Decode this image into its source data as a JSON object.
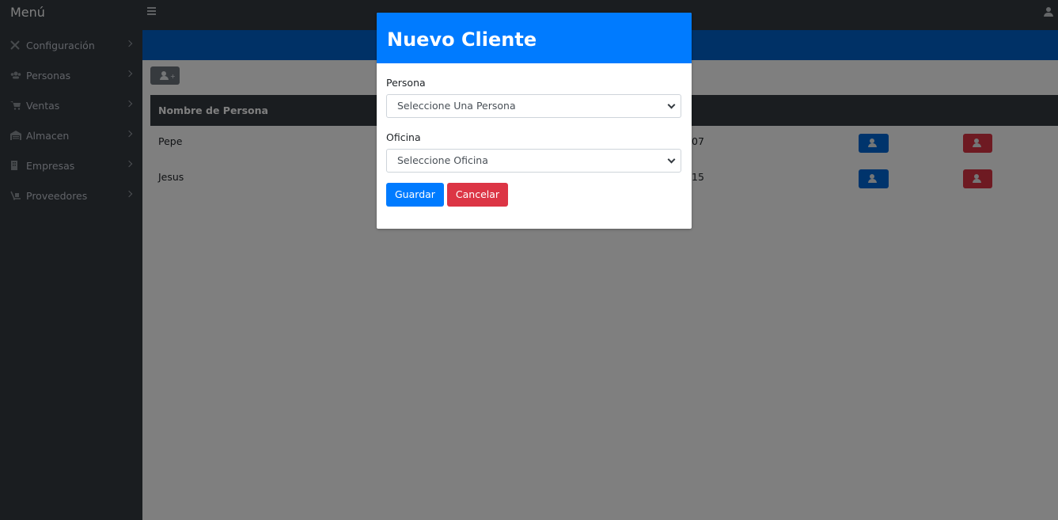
{
  "header": {
    "brand": "Menú"
  },
  "sidebar": {
    "items": [
      {
        "label": "Configuración",
        "icon": "tools-icon"
      },
      {
        "label": "Personas",
        "icon": "users-icon"
      },
      {
        "label": "Ventas",
        "icon": "cart-icon"
      },
      {
        "label": "Almacen",
        "icon": "warehouse-icon"
      },
      {
        "label": "Empresas",
        "icon": "building-icon"
      },
      {
        "label": "Proveedores",
        "icon": "truck-dolly-icon"
      }
    ]
  },
  "table": {
    "header": "Nombre de Persona",
    "rows": [
      {
        "name": "Pepe",
        "num": "07"
      },
      {
        "name": "Jesus",
        "num": "15"
      }
    ]
  },
  "modal": {
    "title": "Nuevo Cliente",
    "persona_label": "Persona",
    "persona_value": "Seleccione Una Persona",
    "oficina_label": "Oficina",
    "oficina_value": "Seleccione Oficina",
    "save_label": "Guardar",
    "cancel_label": "Cancelar"
  },
  "colors": {
    "primary": "#007bff",
    "danger": "#dc3545",
    "dark": "#343a40"
  }
}
